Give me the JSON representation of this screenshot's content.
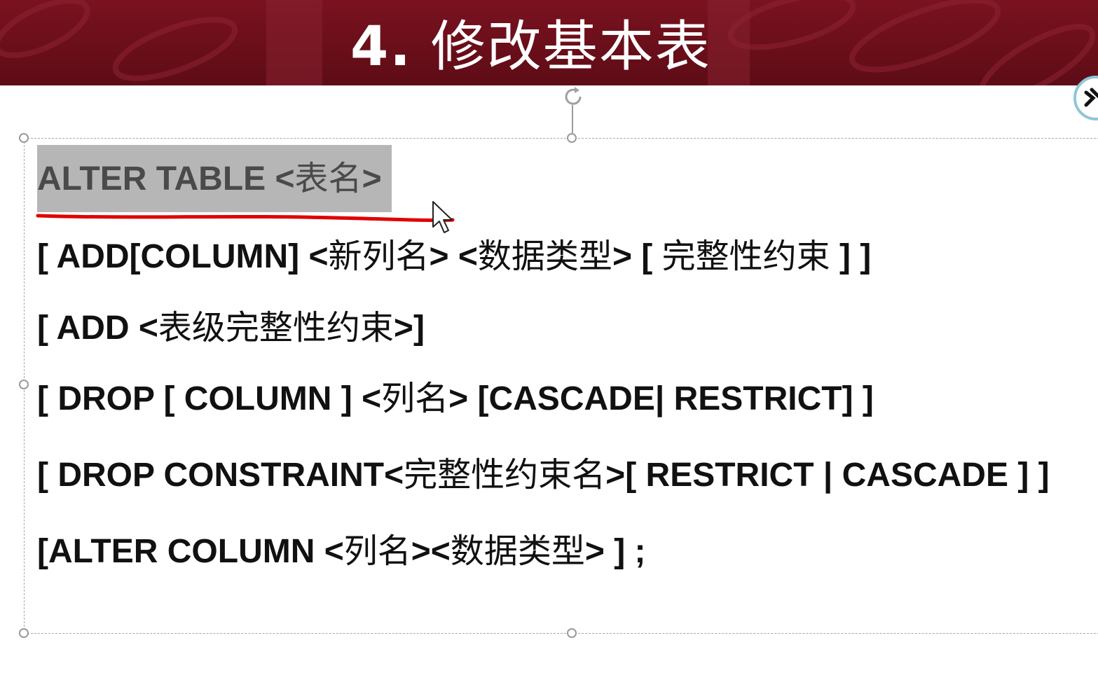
{
  "slide": {
    "title_number": "4.",
    "title_text": "修改基本表"
  },
  "syntax_lines": [
    {
      "segments": [
        {
          "text": "ALTER TABLE <",
          "style": "latin"
        },
        {
          "text": "表名",
          "style": "cn"
        },
        {
          "text": ">",
          "style": "latin"
        }
      ],
      "highlighted": true
    },
    {
      "segments": [
        {
          "text": "[ ADD[COLUMN] <",
          "style": "latin"
        },
        {
          "text": "新列名",
          "style": "cn"
        },
        {
          "text": "> <",
          "style": "latin"
        },
        {
          "text": "数据类型",
          "style": "cn"
        },
        {
          "text": "> [ ",
          "style": "latin"
        },
        {
          "text": "完整性约束",
          "style": "cn"
        },
        {
          "text": " ] ]",
          "style": "latin"
        }
      ]
    },
    {
      "segments": [
        {
          "text": "[ ADD <",
          "style": "latin"
        },
        {
          "text": "表级完整性约束",
          "style": "cn"
        },
        {
          "text": ">]",
          "style": "latin"
        }
      ]
    },
    {
      "segments": [
        {
          "text": "[ DROP [ COLUMN ] <",
          "style": "latin"
        },
        {
          "text": "列名",
          "style": "cn"
        },
        {
          "text": "> [CASCADE| RESTRICT] ]",
          "style": "latin"
        }
      ]
    },
    {
      "segments": [
        {
          "text": "[ DROP CONSTRAINT<",
          "style": "latin"
        },
        {
          "text": "完整性约束名",
          "style": "cn"
        },
        {
          "text": ">[ RESTRICT | CASCADE ] ]",
          "style": "latin"
        }
      ]
    },
    {
      "segments": [
        {
          "text": "[ALTER COLUMN <",
          "style": "latin"
        },
        {
          "text": "列名",
          "style": "cn"
        },
        {
          "text": "><",
          "style": "latin"
        },
        {
          "text": "数据类型",
          "style": "cn"
        },
        {
          "text": "> ] ;",
          "style": "latin"
        }
      ]
    }
  ],
  "colors": {
    "title_bar": "#6a0f1a",
    "highlight": "#b6b6b6",
    "annotation_underline": "#e00000"
  },
  "icons": {
    "rotate": "rotate-handle-icon",
    "cursor": "mouse-pointer-icon",
    "side_widget": "floating-toolbar-icon"
  }
}
